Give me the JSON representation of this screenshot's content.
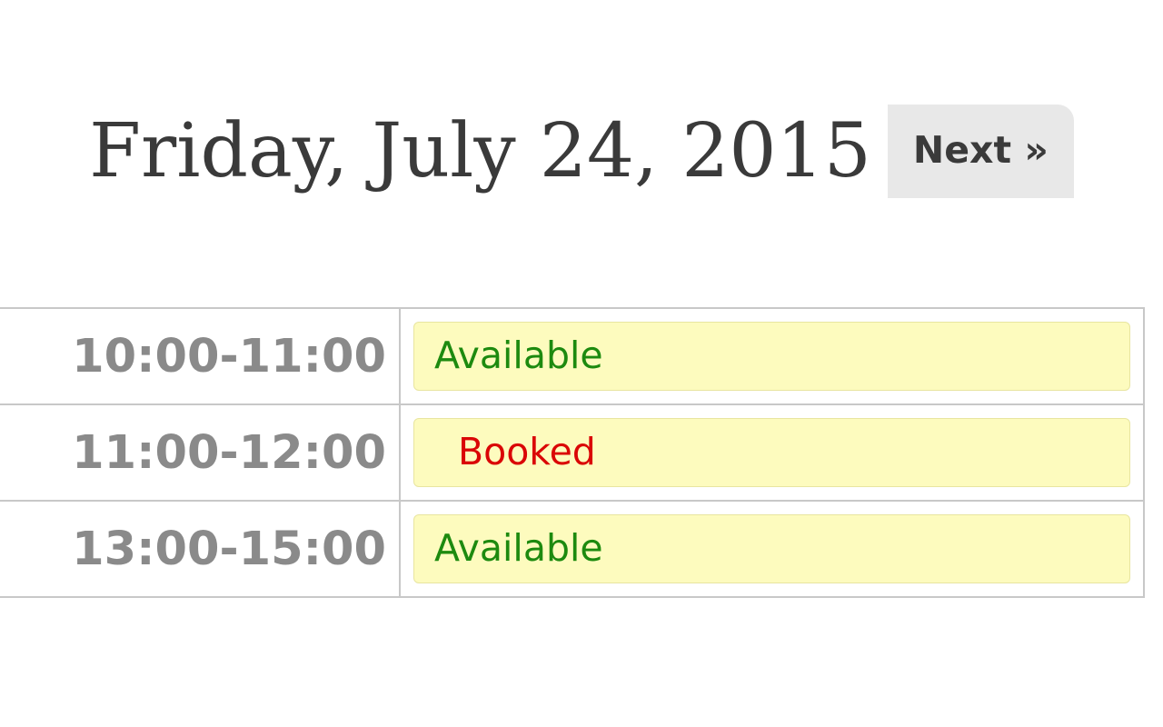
{
  "header": {
    "date_title": "Friday, July 24, 2015",
    "next_label": "Next »"
  },
  "schedule": {
    "rows": [
      {
        "time_range": "10:00-11:00",
        "status_text": "Available",
        "status": "available"
      },
      {
        "time_range": "11:00-12:00",
        "status_text": "Booked",
        "status": "booked"
      },
      {
        "time_range": "13:00-15:00",
        "status_text": "Available",
        "status": "available"
      }
    ]
  },
  "colors": {
    "available": "#1d8a0f",
    "booked": "#da0606",
    "pill_bg": "#fdfbbe"
  }
}
